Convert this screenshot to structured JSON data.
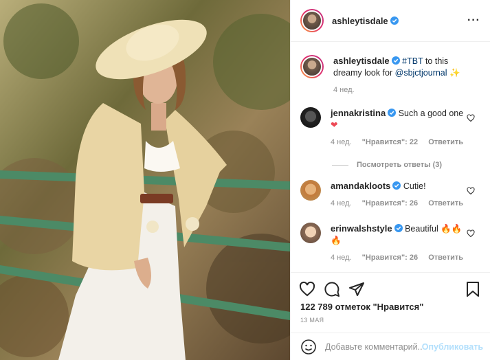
{
  "post": {
    "author": "ashleytisdale",
    "more_icon": "more-horizontal-icon",
    "verified_icon": "verified-badge-icon"
  },
  "caption": {
    "author": "ashleytisdale",
    "hashtag": "#TBT",
    "text_mid": " to this dreamy look for ",
    "mention": "@sbjctjournal",
    "emoji": "✨",
    "time": "4 нед."
  },
  "comments": [
    {
      "user": "jennakristina",
      "text": "Such a good one",
      "emoji": "❤",
      "time": "4 нед.",
      "likes": "\"Нравится\": 22",
      "reply": "Ответить"
    },
    {
      "user": "amandakloots",
      "text": "Cutie!",
      "emoji": "",
      "time": "4 нед.",
      "likes": "\"Нравится\": 26",
      "reply": "Ответить"
    },
    {
      "user": "erinwalshstyle",
      "text": "Beautiful 🔥🔥",
      "emoji": "🔥",
      "time": "4 нед.",
      "likes": "\"Нравится\": 26",
      "reply": "Ответить"
    }
  ],
  "view_replies": "Посмотреть ответы (3)",
  "likes_count": "122 789 отметок \"Нравится\"",
  "date": "13 мая",
  "composer": {
    "placeholder": "Добавьте комментарий...",
    "post_label": "Опубликовать"
  },
  "colors": {
    "accent": "#0095f6",
    "heart_red": "#ed4956",
    "verified": "#3897f0"
  }
}
